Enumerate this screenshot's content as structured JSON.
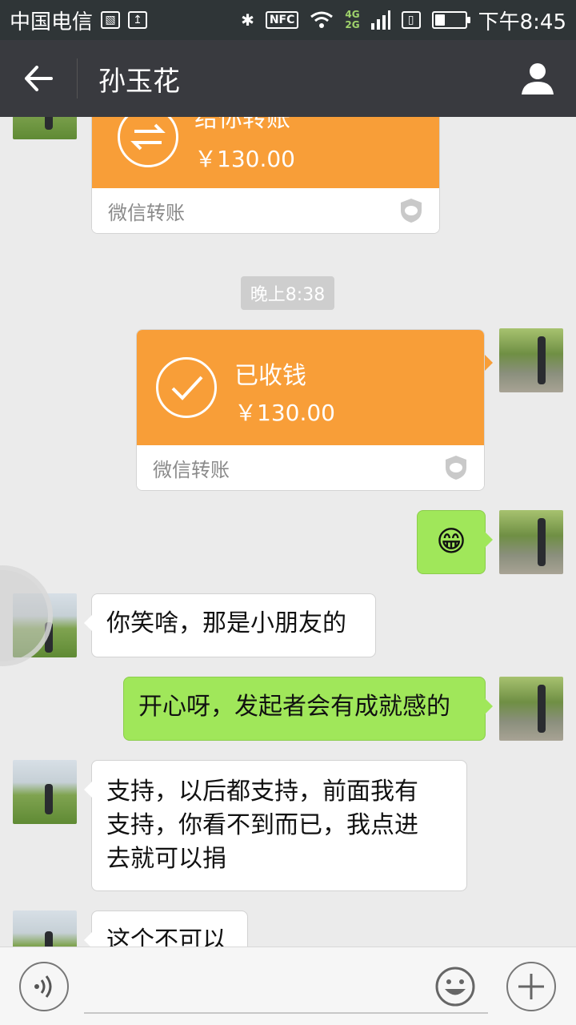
{
  "status_bar": {
    "carrier": "中国电信",
    "nfc": "NFC",
    "net_top": "4G",
    "net_bottom": "2G",
    "battery_level": 0.35,
    "time": "下午8:45"
  },
  "header": {
    "title": "孙玉花"
  },
  "messages": {
    "partial_card": {
      "title": "给你转账",
      "amount": "￥130.00",
      "footer": "微信转账"
    },
    "timestamp": "晚上8:38",
    "received_card": {
      "title": "已收钱",
      "amount": "￥130.00",
      "footer": "微信转账"
    },
    "emoji": "😁",
    "msg1": "你笑啥，那是小朋友的",
    "msg2": "开心呀，发起者会有成就感的",
    "msg3_line1": "支持，以后都支持，前面我有",
    "msg3_line2": "支持，你看不到而已，我点进",
    "msg3_line3": "去就可以捐",
    "msg4": "这个不可以"
  },
  "colors": {
    "orange": "#f89e38",
    "green_bubble": "#a0e75a",
    "title_bar": "#393a3f",
    "status_bar": "#2f3537"
  }
}
